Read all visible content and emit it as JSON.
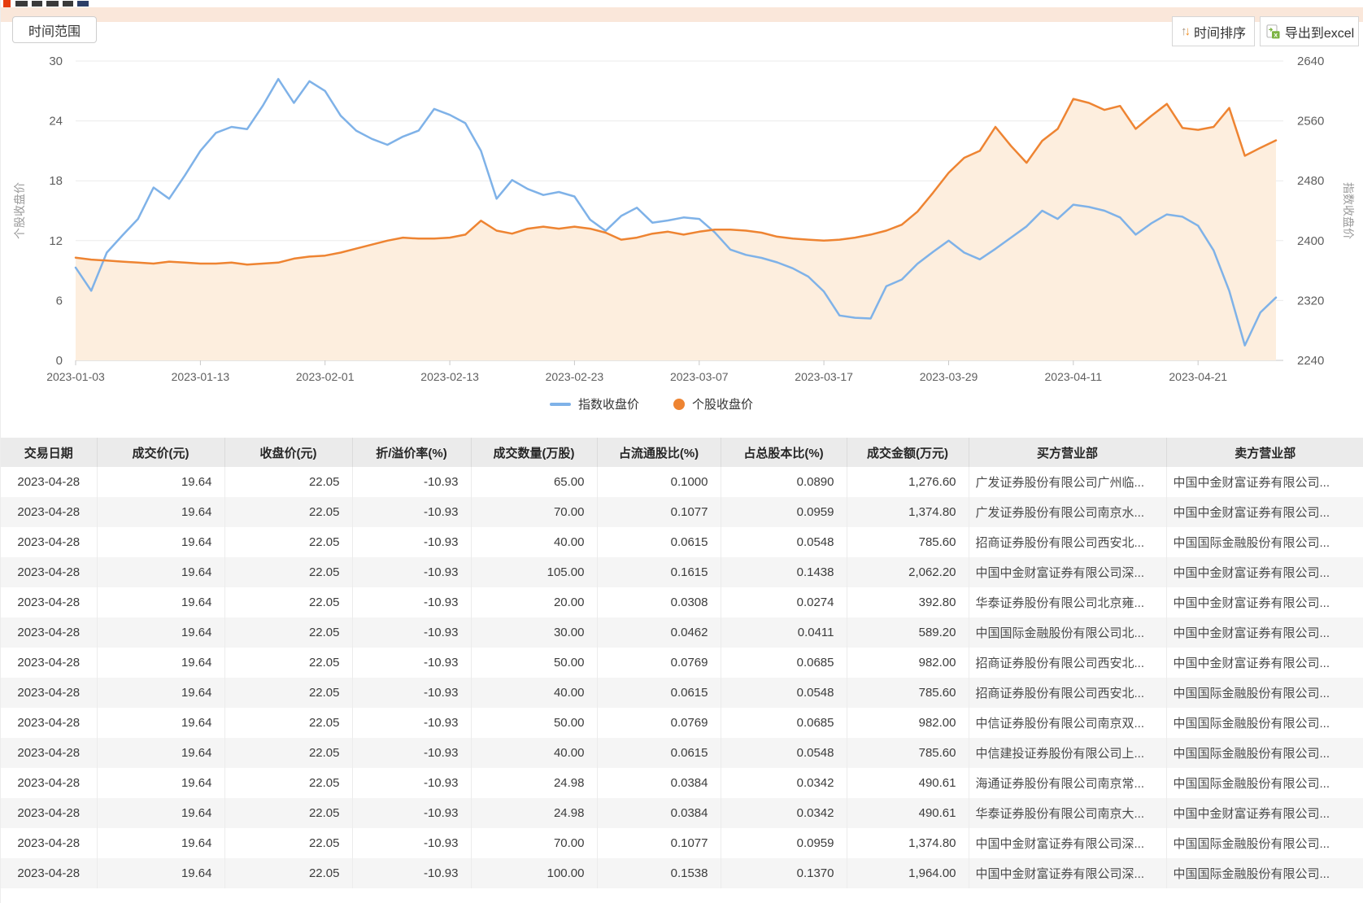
{
  "toolbar": {
    "time_range_label": "时间范围",
    "time_sort_label": "时间排序",
    "export_excel_label": "导出到excel"
  },
  "chart_data": {
    "type": "line",
    "title": "",
    "grid": true,
    "legend_position": "bottom",
    "x_tick_labels": [
      "2023-01-03",
      "2023-01-13",
      "2023-02-01",
      "2023-02-13",
      "2023-02-23",
      "2023-03-07",
      "2023-03-17",
      "2023-03-29",
      "2023-04-11",
      "2023-04-21"
    ],
    "x_tick_indices": [
      0,
      8,
      16,
      24,
      32,
      40,
      48,
      56,
      64,
      72
    ],
    "left_axis": {
      "label": "个股收盘价",
      "min": 0,
      "max": 30,
      "ticks": [
        30,
        24,
        18,
        12,
        6,
        0
      ]
    },
    "right_axis": {
      "label": "指数收盘价",
      "min": 2240,
      "max": 2640,
      "ticks": [
        2640,
        2560,
        2480,
        2400,
        2320,
        2240
      ]
    },
    "series": [
      {
        "name": "指数收盘价",
        "axis": "right",
        "type": "line",
        "color": "#7fb2e8",
        "values": [
          2364,
          2333,
          2384,
          2407,
          2429,
          2471,
          2456,
          2487,
          2520,
          2544,
          2552,
          2549,
          2580,
          2616,
          2584,
          2613,
          2600,
          2567,
          2547,
          2536,
          2528,
          2539,
          2547,
          2576,
          2568,
          2557,
          2520,
          2456,
          2481,
          2469,
          2461,
          2465,
          2459,
          2428,
          2413,
          2433,
          2444,
          2424,
          2427,
          2431,
          2429,
          2411,
          2388,
          2381,
          2377,
          2371,
          2363,
          2352,
          2332,
          2300,
          2297,
          2296,
          2339,
          2348,
          2369,
          2385,
          2400,
          2384,
          2375,
          2389,
          2404,
          2419,
          2440,
          2429,
          2448,
          2445,
          2440,
          2431,
          2408,
          2423,
          2435,
          2432,
          2420,
          2387,
          2333,
          2260,
          2304,
          2324
        ]
      },
      {
        "name": "个股收盘价",
        "axis": "left",
        "type": "area",
        "color": "#ee8432",
        "fill": "#fdeede",
        "values": [
          10.3,
          10.1,
          10.0,
          9.9,
          9.8,
          9.7,
          9.9,
          9.8,
          9.7,
          9.7,
          9.8,
          9.6,
          9.7,
          9.8,
          10.2,
          10.4,
          10.5,
          10.8,
          11.2,
          11.6,
          12.0,
          12.3,
          12.2,
          12.2,
          12.3,
          12.6,
          14.0,
          13.0,
          12.7,
          13.2,
          13.4,
          13.2,
          13.4,
          13.2,
          12.8,
          12.1,
          12.3,
          12.7,
          12.9,
          12.6,
          12.9,
          13.1,
          13.1,
          13.0,
          12.8,
          12.4,
          12.2,
          12.1,
          12.0,
          12.1,
          12.3,
          12.6,
          13.0,
          13.6,
          14.9,
          16.8,
          18.8,
          20.3,
          21.0,
          23.4,
          21.5,
          19.8,
          22.0,
          23.2,
          26.2,
          25.8,
          25.1,
          25.5,
          23.2,
          24.5,
          25.7,
          23.3,
          23.1,
          23.4,
          25.3,
          20.5,
          21.3,
          22.05
        ]
      }
    ]
  },
  "table": {
    "columns": [
      "交易日期",
      "成交价(元)",
      "收盘价(元)",
      "折/溢价率(%)",
      "成交数量(万股)",
      "占流通股比(%)",
      "占总股本比(%)",
      "成交金额(万元)",
      "买方营业部",
      "卖方营业部"
    ],
    "rows": [
      [
        "2023-04-28",
        "19.64",
        "22.05",
        "-10.93",
        "65.00",
        "0.1000",
        "0.0890",
        "1,276.60",
        "广发证券股份有限公司广州临...",
        "中国中金财富证券有限公司..."
      ],
      [
        "2023-04-28",
        "19.64",
        "22.05",
        "-10.93",
        "70.00",
        "0.1077",
        "0.0959",
        "1,374.80",
        "广发证券股份有限公司南京水...",
        "中国中金财富证券有限公司..."
      ],
      [
        "2023-04-28",
        "19.64",
        "22.05",
        "-10.93",
        "40.00",
        "0.0615",
        "0.0548",
        "785.60",
        "招商证券股份有限公司西安北...",
        "中国国际金融股份有限公司..."
      ],
      [
        "2023-04-28",
        "19.64",
        "22.05",
        "-10.93",
        "105.00",
        "0.1615",
        "0.1438",
        "2,062.20",
        "中国中金财富证券有限公司深...",
        "中国中金财富证券有限公司..."
      ],
      [
        "2023-04-28",
        "19.64",
        "22.05",
        "-10.93",
        "20.00",
        "0.0308",
        "0.0274",
        "392.80",
        "华泰证券股份有限公司北京雍...",
        "中国中金财富证券有限公司..."
      ],
      [
        "2023-04-28",
        "19.64",
        "22.05",
        "-10.93",
        "30.00",
        "0.0462",
        "0.0411",
        "589.20",
        "中国国际金融股份有限公司北...",
        "中国中金财富证券有限公司..."
      ],
      [
        "2023-04-28",
        "19.64",
        "22.05",
        "-10.93",
        "50.00",
        "0.0769",
        "0.0685",
        "982.00",
        "招商证券股份有限公司西安北...",
        "中国中金财富证券有限公司..."
      ],
      [
        "2023-04-28",
        "19.64",
        "22.05",
        "-10.93",
        "40.00",
        "0.0615",
        "0.0548",
        "785.60",
        "招商证券股份有限公司西安北...",
        "中国国际金融股份有限公司..."
      ],
      [
        "2023-04-28",
        "19.64",
        "22.05",
        "-10.93",
        "50.00",
        "0.0769",
        "0.0685",
        "982.00",
        "中信证券股份有限公司南京双...",
        "中国国际金融股份有限公司..."
      ],
      [
        "2023-04-28",
        "19.64",
        "22.05",
        "-10.93",
        "40.00",
        "0.0615",
        "0.0548",
        "785.60",
        "中信建投证券股份有限公司上...",
        "中国国际金融股份有限公司..."
      ],
      [
        "2023-04-28",
        "19.64",
        "22.05",
        "-10.93",
        "24.98",
        "0.0384",
        "0.0342",
        "490.61",
        "海通证券股份有限公司南京常...",
        "中国国际金融股份有限公司..."
      ],
      [
        "2023-04-28",
        "19.64",
        "22.05",
        "-10.93",
        "24.98",
        "0.0384",
        "0.0342",
        "490.61",
        "华泰证券股份有限公司南京大...",
        "中国中金财富证券有限公司..."
      ],
      [
        "2023-04-28",
        "19.64",
        "22.05",
        "-10.93",
        "70.00",
        "0.1077",
        "0.0959",
        "1,374.80",
        "中国中金财富证券有限公司深...",
        "中国国际金融股份有限公司..."
      ],
      [
        "2023-04-28",
        "19.64",
        "22.05",
        "-10.93",
        "100.00",
        "0.1538",
        "0.1370",
        "1,964.00",
        "中国中金财富证券有限公司深...",
        "中国国际金融股份有限公司..."
      ]
    ]
  }
}
